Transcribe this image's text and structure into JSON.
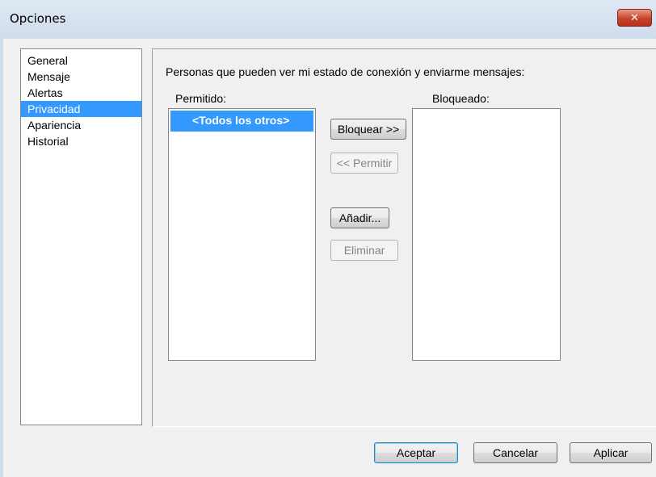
{
  "window": {
    "title": "Opciones",
    "close_glyph": "✕"
  },
  "nav": {
    "items": [
      "General",
      "Mensaje",
      "Alertas",
      "Privacidad",
      "Apariencia",
      "Historial"
    ],
    "selected": "Privacidad"
  },
  "privacy": {
    "description": "Personas que pueden ver mi estado de conexión y enviarme mensajes:",
    "allowed_label": "Permitido:",
    "allowed_items": [
      "<Todos los otros>"
    ],
    "blocked_label": "Bloqueado:",
    "blocked_items": [],
    "block_button": "Bloquear >>",
    "allow_button": "<< Permitir",
    "add_button": "Añadir...",
    "remove_button": "Eliminar"
  },
  "footer": {
    "ok": "Aceptar",
    "cancel": "Cancelar",
    "apply": "Aplicar"
  },
  "colors": {
    "selection": "#3399ff",
    "close_button": "#c7432a"
  }
}
